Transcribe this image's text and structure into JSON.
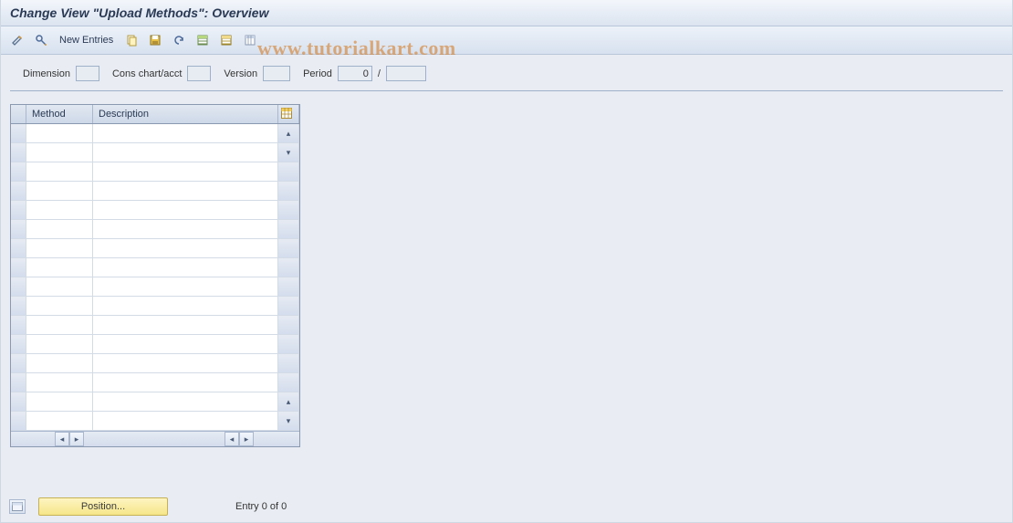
{
  "title": "Change View \"Upload Methods\": Overview",
  "watermark": "www.tutorialkart.com",
  "toolbar": {
    "new_entries": "New Entries"
  },
  "params": {
    "dimension_label": "Dimension",
    "dimension_value": "",
    "cons_label": "Cons chart/acct",
    "cons_value": "",
    "version_label": "Version",
    "version_value": "",
    "period_label": "Period",
    "period_value": "0",
    "period_sep": "/",
    "period_value2": ""
  },
  "table": {
    "col_method": "Method",
    "col_description": "Description",
    "rows": 16
  },
  "footer": {
    "position": "Position...",
    "entry": "Entry 0 of 0"
  }
}
